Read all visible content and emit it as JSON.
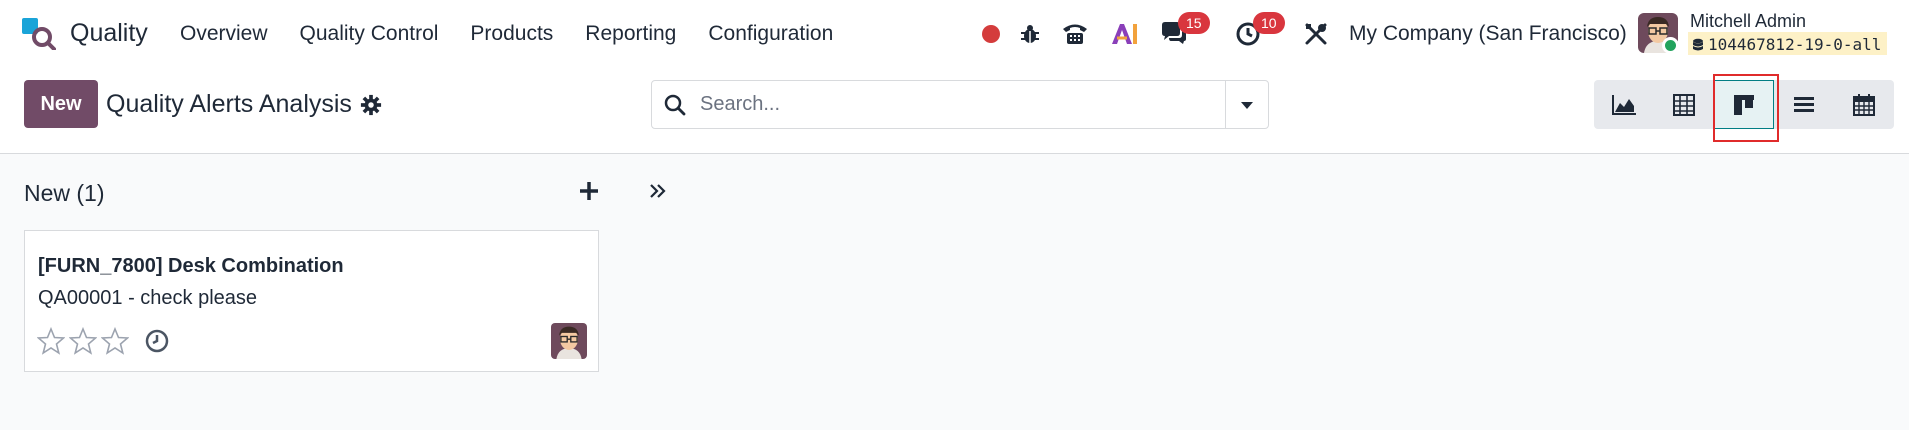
{
  "app": {
    "name": "Quality"
  },
  "menu": [
    "Overview",
    "Quality Control",
    "Products",
    "Reporting",
    "Configuration"
  ],
  "systray": {
    "messages_count": "15",
    "activities_count": "10",
    "company": "My Company (San Francisco)",
    "user_name": "Mitchell Admin",
    "database": "104467812-19-0-all"
  },
  "control_panel": {
    "new_label": "New",
    "title": "Quality Alerts Analysis",
    "search_placeholder": "Search...",
    "views": [
      "graph",
      "pivot",
      "kanban",
      "list",
      "calendar"
    ],
    "active_view": "kanban"
  },
  "kanban": {
    "column_title": "New (1)",
    "cards": [
      {
        "title": "[FURN_7800] Desk Combination",
        "subtitle": "QA00001 - check please",
        "priority_stars": 0,
        "max_stars": 3
      }
    ]
  },
  "colors": {
    "brand": "#714b67",
    "badge": "#d9363e",
    "record": "#d43c3c",
    "active_view_border": "#017e84",
    "highlight": "#e02b2b"
  }
}
